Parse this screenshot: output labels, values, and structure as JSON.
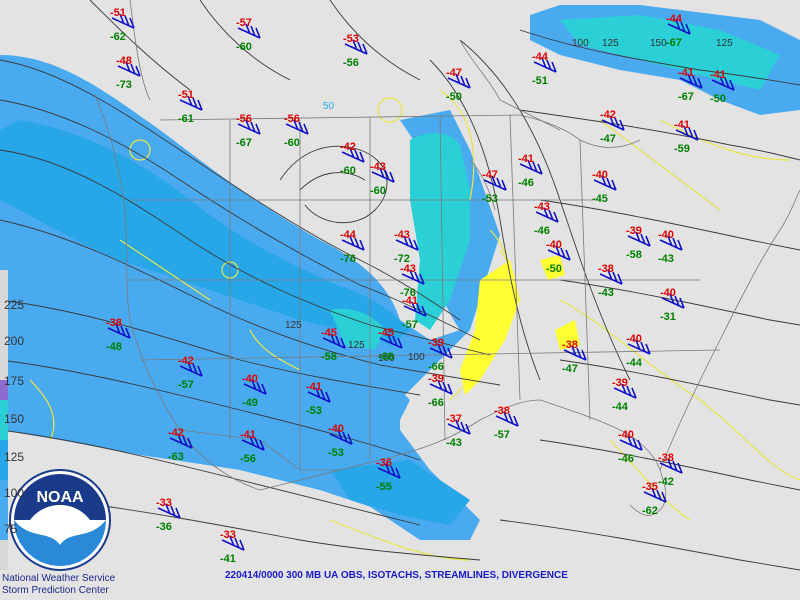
{
  "product": "220414/0000 300 MB UA OBS, ISOTACHS, STREAMLINES, DIVERGENCE",
  "agency": {
    "line1": "National Weather Service",
    "line2": "Storm Prediction Center",
    "logo_text": "NOAA"
  },
  "legend_ticks": [
    "225",
    "200",
    "175",
    "150",
    "125",
    "100",
    "75"
  ],
  "colors": {
    "jet_light": "#4aaaf0",
    "jet_mid": "#27a6e8",
    "jet_core": "#2ad0d6",
    "div": "#e6e64a",
    "temp": "#e00000",
    "dewpt": "#008000",
    "barb": "#1010c8"
  },
  "isotach_labels": [
    "50",
    "100",
    "125",
    "100",
    "125",
    "150",
    "125",
    "100",
    "125"
  ],
  "observations": [
    {
      "t": "-51",
      "d": "-62"
    },
    {
      "t": "-48",
      "d": "-73"
    },
    {
      "t": "-51",
      "d": "-61"
    },
    {
      "t": "-57",
      "d": "-60"
    },
    {
      "t": "-53",
      "d": "-56"
    },
    {
      "t": "-56",
      "d": "-67"
    },
    {
      "t": "-56",
      "d": "-60"
    },
    {
      "t": "-42",
      "d": "-60"
    },
    {
      "t": "-43",
      "d": "-60"
    },
    {
      "t": "-47",
      "d": "-50"
    },
    {
      "t": "-44",
      "d": "-51"
    },
    {
      "t": "-44",
      "d": "-67"
    },
    {
      "t": "-41",
      "d": "-67"
    },
    {
      "t": "-41",
      "d": "-50"
    },
    {
      "t": "-42",
      "d": "-47"
    },
    {
      "t": "-41",
      "d": "-59"
    },
    {
      "t": "-47",
      "d": "-53"
    },
    {
      "t": "-41",
      "d": "-46"
    },
    {
      "t": "-43",
      "d": "-46"
    },
    {
      "t": "-40",
      "d": "-45"
    },
    {
      "t": "-40",
      "d": "-50"
    },
    {
      "t": "-39",
      "d": "-58"
    },
    {
      "t": "-40",
      "d": "-43"
    },
    {
      "t": "-38",
      "d": "-43"
    },
    {
      "t": "-40",
      "d": "-31"
    },
    {
      "t": "-40",
      "d": "-44"
    },
    {
      "t": "-38",
      "d": "-47"
    },
    {
      "t": "-39",
      "d": "-44"
    },
    {
      "t": "-40",
      "d": "-46"
    },
    {
      "t": "-38",
      "d": "-42"
    },
    {
      "t": "-35",
      "d": "-62"
    },
    {
      "t": "-37",
      "d": "-43"
    },
    {
      "t": "-38",
      "d": "-57"
    },
    {
      "t": "-39",
      "d": "-66"
    },
    {
      "t": "-36",
      "d": "-55"
    },
    {
      "t": "-33",
      "d": "-36"
    },
    {
      "t": "-33",
      "d": "-41"
    },
    {
      "t": "-38",
      "d": "-48"
    },
    {
      "t": "-42",
      "d": "-57"
    },
    {
      "t": "-40",
      "d": "-49"
    },
    {
      "t": "-41",
      "d": "-53"
    },
    {
      "t": "-40",
      "d": "-53"
    },
    {
      "t": "-41",
      "d": "-56"
    },
    {
      "t": "-42",
      "d": "-63"
    },
    {
      "t": "-43",
      "d": "-72"
    },
    {
      "t": "-44",
      "d": "-76"
    },
    {
      "t": "-43",
      "d": "-76"
    },
    {
      "t": "-41",
      "d": "-57"
    },
    {
      "t": "-45",
      "d": "-58"
    },
    {
      "t": "-45",
      "d": "-68"
    },
    {
      "t": "-39",
      "d": "-66"
    }
  ]
}
